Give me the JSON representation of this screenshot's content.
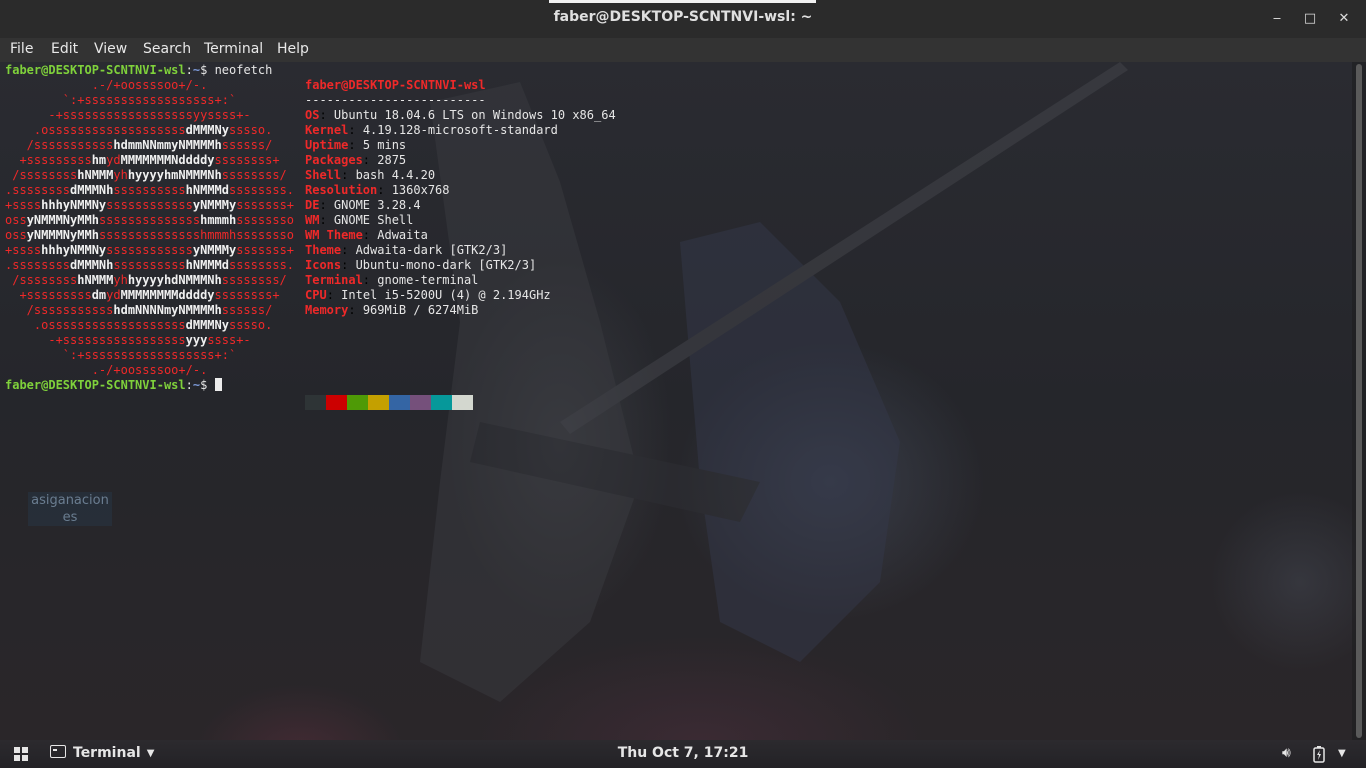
{
  "window": {
    "title": "faber@DESKTOP-SCNTNVI-wsl: ~",
    "minimize_label": "‒",
    "maximize_label": "□",
    "close_label": "✕"
  },
  "menu": {
    "items": [
      "File",
      "Edit",
      "View",
      "Search",
      "Terminal",
      "Help"
    ]
  },
  "terminal": {
    "prompt_user": "faber@DESKTOP-SCNTNVI-wsl",
    "prompt_path": "~",
    "prompt_symbol": "$",
    "command": "neofetch",
    "info_header": "faber@DESKTOP-SCNTNVI-wsl",
    "info_separator": "-------------------------",
    "info": [
      {
        "key": "OS",
        "value": "Ubuntu 18.04.6 LTS on Windows 10 x86_64"
      },
      {
        "key": "Kernel",
        "value": "4.19.128-microsoft-standard"
      },
      {
        "key": "Uptime",
        "value": "5 mins"
      },
      {
        "key": "Packages",
        "value": "2875"
      },
      {
        "key": "Shell",
        "value": "bash 4.4.20"
      },
      {
        "key": "Resolution",
        "value": "1360x768"
      },
      {
        "key": "DE",
        "value": "GNOME 3.28.4"
      },
      {
        "key": "WM",
        "value": "GNOME Shell"
      },
      {
        "key": "WM Theme",
        "value": "Adwaita"
      },
      {
        "key": "Theme",
        "value": "Adwaita-dark [GTK2/3]"
      },
      {
        "key": "Icons",
        "value": "Ubuntu-mono-dark [GTK2/3]"
      },
      {
        "key": "Terminal",
        "value": "gnome-terminal"
      },
      {
        "key": "CPU",
        "value": "Intel i5-5200U (4) @ 2.194GHz"
      },
      {
        "key": "Memory",
        "value": "969MiB / 6274MiB"
      }
    ],
    "palette": [
      "#2e3436",
      "#cc0000",
      "#4e9a06",
      "#c4a000",
      "#3465a4",
      "#75507b",
      "#06989a",
      "#d3d7cf"
    ],
    "ascii_logo": [
      [
        [
          "r",
          "            .-/+oossssoo+/-.               "
        ]
      ],
      [
        [
          "r",
          "        `:+ssssssssssssssssss+:`           "
        ]
      ],
      [
        [
          "r",
          "      -+ssssssssssssssssssyyssss+-         "
        ]
      ],
      [
        [
          "r",
          "    .osssssssssssssssssss"
        ],
        [
          "w",
          "dMMMNy"
        ],
        [
          "r",
          "sssso.       "
        ]
      ],
      [
        [
          "r",
          "   /sssssssssss"
        ],
        [
          "w",
          "hdmmNNmmyNMMMMh"
        ],
        [
          "r",
          "ssssss/      "
        ]
      ],
      [
        [
          "r",
          "  +sssssssss"
        ],
        [
          "w",
          "hm"
        ],
        [
          "r",
          "yd"
        ],
        [
          "w",
          "MMMMMMMNddddy"
        ],
        [
          "r",
          "ssssssss+     "
        ]
      ],
      [
        [
          "r",
          " /ssssssss"
        ],
        [
          "w",
          "hNMMM"
        ],
        [
          "r",
          "yh"
        ],
        [
          "w",
          "hyyyyhmNMMMNh"
        ],
        [
          "r",
          "ssssssss/    "
        ]
      ],
      [
        [
          "r",
          ".ssssssss"
        ],
        [
          "w",
          "dMMMNh"
        ],
        [
          "r",
          "ssssssssss"
        ],
        [
          "w",
          "hNMMMd"
        ],
        [
          "r",
          "ssssssss.    "
        ]
      ],
      [
        [
          "r",
          "+ssss"
        ],
        [
          "w",
          "hhhyNMMNy"
        ],
        [
          "r",
          "ssssssssssss"
        ],
        [
          "w",
          "yNMMMy"
        ],
        [
          "r",
          "sssssss+    "
        ]
      ],
      [
        [
          "r",
          "oss"
        ],
        [
          "w",
          "yNMMMNyMMh"
        ],
        [
          "r",
          "ssssssssssssss"
        ],
        [
          "w",
          "hmmmh"
        ],
        [
          "r",
          "ssssssso    "
        ]
      ],
      [
        [
          "r",
          "oss"
        ],
        [
          "w",
          "yNMMMNyMMh"
        ],
        [
          "r",
          "sssssssssssssshmmmhssssssso    "
        ]
      ],
      [
        [
          "r",
          "+ssss"
        ],
        [
          "w",
          "hhhyNMMNy"
        ],
        [
          "r",
          "ssssssssssss"
        ],
        [
          "w",
          "yNMMMy"
        ],
        [
          "r",
          "sssssss+    "
        ]
      ],
      [
        [
          "r",
          ".ssssssss"
        ],
        [
          "w",
          "dMMMNh"
        ],
        [
          "r",
          "ssssssssss"
        ],
        [
          "w",
          "hNMMMd"
        ],
        [
          "r",
          "ssssssss.    "
        ]
      ],
      [
        [
          "r",
          " /ssssssss"
        ],
        [
          "w",
          "hNMMM"
        ],
        [
          "r",
          "yh"
        ],
        [
          "w",
          "hyyyyhdNMMMNh"
        ],
        [
          "r",
          "ssssssss/    "
        ]
      ],
      [
        [
          "r",
          "  +sssssssss"
        ],
        [
          "w",
          "dm"
        ],
        [
          "r",
          "yd"
        ],
        [
          "w",
          "MMMMMMMMddddy"
        ],
        [
          "r",
          "ssssssss+     "
        ]
      ],
      [
        [
          "r",
          "   /sssssssssss"
        ],
        [
          "w",
          "hdmNNNNmyNMMMMh"
        ],
        [
          "r",
          "ssssss/      "
        ]
      ],
      [
        [
          "r",
          "    .osssssssssssssssssss"
        ],
        [
          "w",
          "dMMMNy"
        ],
        [
          "r",
          "sssso.       "
        ]
      ],
      [
        [
          "r",
          "      -+sssssssssssssssss"
        ],
        [
          "w",
          "yyy"
        ],
        [
          "r",
          "ssss+-         "
        ]
      ],
      [
        [
          "r",
          "        `:+ssssssssssssssssss+:`           "
        ]
      ],
      [
        [
          "r",
          "            .-/+oossssoo+/-.               "
        ]
      ]
    ]
  },
  "desktop": {
    "icon_label": "asiganacion es"
  },
  "taskbar": {
    "active_app": "Terminal",
    "clock": "Thu Oct  7, 17:21"
  }
}
